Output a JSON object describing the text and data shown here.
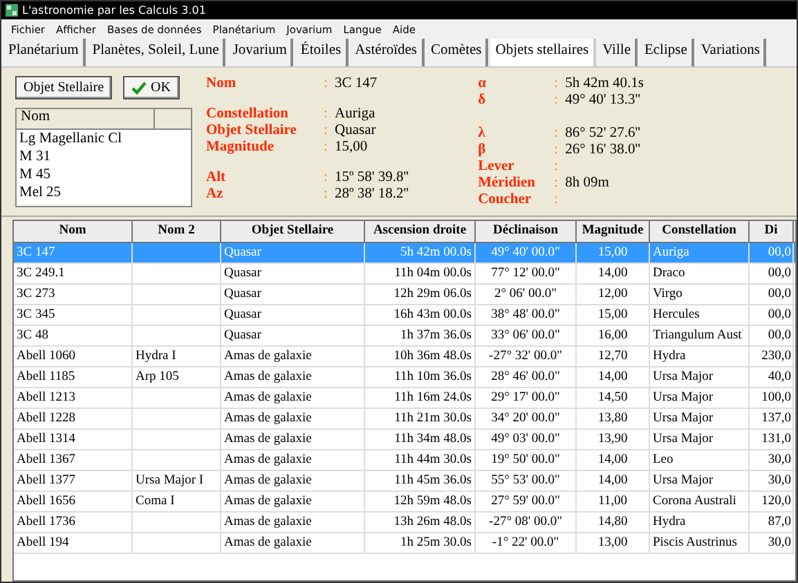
{
  "window": {
    "title": "L'astronomie par les Calculs 3.01"
  },
  "menu": [
    "Fichier",
    "Afficher",
    "Bases de données",
    "Planétarium",
    "Jovarium",
    "Langue",
    "Aide"
  ],
  "tabs": [
    {
      "label": "Planétarium",
      "selected": false
    },
    {
      "label": "Planètes, Soleil, Lune",
      "selected": false
    },
    {
      "label": "Jovarium",
      "selected": false
    },
    {
      "label": "Étoiles",
      "selected": false
    },
    {
      "label": "Astéroïdes",
      "selected": false
    },
    {
      "label": "Comètes",
      "selected": false
    },
    {
      "label": "Objets stellaires",
      "selected": true
    },
    {
      "label": "Ville",
      "selected": false
    },
    {
      "label": "Eclipse",
      "selected": false
    },
    {
      "label": "Variations",
      "selected": false
    }
  ],
  "object_button": "Objet Stellaire",
  "ok_button": "OK",
  "name_list": {
    "column": "Nom",
    "items": [
      "Lg Magellanic Cl",
      "M 31",
      "M 45",
      "Mel 25"
    ]
  },
  "info_left": [
    [
      {
        "label": "Nom",
        "colon": ":",
        "value": "3C 147"
      }
    ],
    [
      {
        "label": "Constellation",
        "colon": ":",
        "value": "Auriga"
      },
      {
        "label": "Objet Stellaire",
        "colon": ":",
        "value": "Quasar"
      },
      {
        "label": "Magnitude",
        "colon": ":",
        "value": "15,00"
      }
    ],
    [
      {
        "label": "Alt",
        "colon": ":",
        "value": "15º 58' 39.8''"
      },
      {
        "label": "Az",
        "colon": ":",
        "value": "28º 38' 18.2''"
      }
    ]
  ],
  "info_right": [
    [
      {
        "label": "α",
        "colon": ":",
        "value": "5h 42m 40.1s"
      },
      {
        "label": "δ",
        "colon": ":",
        "value": "49° 40' 13.3''"
      }
    ],
    [
      {
        "label": "λ",
        "colon": ":",
        "value": "86° 52' 27.6''"
      },
      {
        "label": "β",
        "colon": ":",
        "value": "26° 16' 38.0''"
      },
      {
        "label": "Lever",
        "colon": ":"
      },
      {
        "label": "Méridien",
        "colon": ":",
        "value": "8h 09m"
      },
      {
        "label": "Coucher",
        "colon": ":"
      }
    ]
  ],
  "table": {
    "columns": [
      "Nom",
      "Nom 2",
      "Objet Stellaire",
      "Ascension droite",
      "Déclinaison",
      "Magnitude",
      "Constellation",
      "Di"
    ],
    "rows": [
      {
        "selected": true,
        "cells": [
          "3C 147",
          "",
          "Quasar",
          "5h 42m 00.0s",
          "49° 40' 00.0\"",
          "15,00",
          "Auriga",
          "00,0"
        ]
      },
      {
        "selected": false,
        "cells": [
          "3C 249.1",
          "",
          "Quasar",
          "11h 04m 00.0s",
          "77° 12' 00.0\"",
          "14,00",
          "Draco",
          "00,0"
        ]
      },
      {
        "selected": false,
        "cells": [
          "3C 273",
          "",
          "Quasar",
          "12h 29m 06.0s",
          "2° 06' 00.0\"",
          "12,00",
          "Virgo",
          "00,0"
        ]
      },
      {
        "selected": false,
        "cells": [
          "3C 345",
          "",
          "Quasar",
          "16h 43m 00.0s",
          "38° 48' 00.0\"",
          "15,00",
          "Hercules",
          "00,0"
        ]
      },
      {
        "selected": false,
        "cells": [
          "3C 48",
          "",
          "Quasar",
          "1h 37m 36.0s",
          "33° 06' 00.0\"",
          "16,00",
          "Triangulum Aust",
          "00,0"
        ]
      },
      {
        "selected": false,
        "cells": [
          "Abell 1060",
          "Hydra I",
          "Amas de galaxie",
          "10h 36m 48.0s",
          "-27° 32' 00.0\"",
          "12,70",
          "Hydra",
          "230,0"
        ]
      },
      {
        "selected": false,
        "cells": [
          "Abell 1185",
          "Arp 105",
          "Amas de galaxie",
          "11h 10m 36.0s",
          "28° 46' 00.0\"",
          "14,00",
          "Ursa Major",
          "40,0"
        ]
      },
      {
        "selected": false,
        "cells": [
          "Abell 1213",
          "",
          "Amas de galaxie",
          "11h 16m 24.0s",
          "29° 17' 00.0\"",
          "14,50",
          "Ursa Major",
          "100,0"
        ]
      },
      {
        "selected": false,
        "cells": [
          "Abell 1228",
          "",
          "Amas de galaxie",
          "11h 21m 30.0s",
          "34° 20' 00.0\"",
          "13,80",
          "Ursa Major",
          "137,0"
        ]
      },
      {
        "selected": false,
        "cells": [
          "Abell 1314",
          "",
          "Amas de galaxie",
          "11h 34m 48.0s",
          "49° 03' 00.0\"",
          "13,90",
          "Ursa Major",
          "131,0"
        ]
      },
      {
        "selected": false,
        "cells": [
          "Abell 1367",
          "",
          "Amas de galaxie",
          "11h 44m 30.0s",
          "19° 50' 00.0\"",
          "14,00",
          "Leo",
          "30,0"
        ]
      },
      {
        "selected": false,
        "cells": [
          "Abell 1377",
          "Ursa Major I",
          "Amas de galaxie",
          "11h 45m 36.0s",
          "55° 53' 00.0\"",
          "14,00",
          "Ursa Major",
          "30,0"
        ]
      },
      {
        "selected": false,
        "cells": [
          "Abell 1656",
          "Coma I",
          "Amas de galaxie",
          "12h 59m 48.0s",
          "27° 59' 00.0\"",
          "11,00",
          "Corona Australi",
          "120,0"
        ]
      },
      {
        "selected": false,
        "cells": [
          "Abell 1736",
          "",
          "Amas de galaxie",
          "13h 26m 48.0s",
          "-27° 08' 00.0\"",
          "14,80",
          "Hydra",
          "87,0"
        ]
      },
      {
        "selected": false,
        "cells": [
          "Abell 194",
          "",
          "Amas de galaxie",
          "1h 25m 30.0s",
          "-1° 22' 00.0\"",
          "13,00",
          "Piscis Austrinus",
          "30,0"
        ]
      }
    ]
  }
}
